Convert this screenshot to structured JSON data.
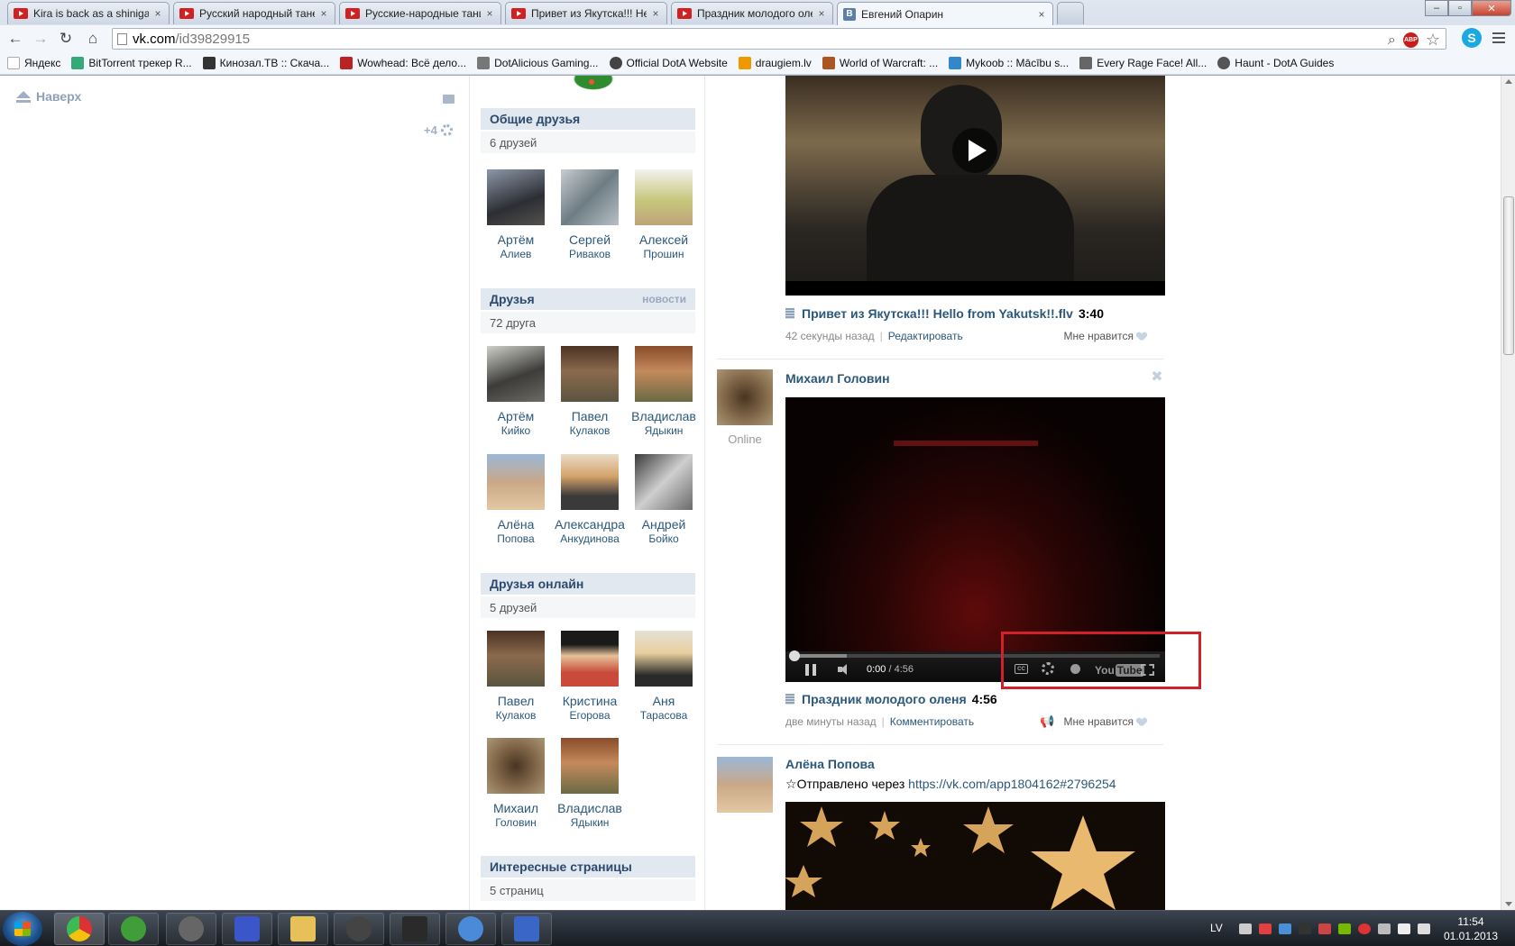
{
  "browser": {
    "tabs": [
      {
        "label": "Kira is back as a shinigami",
        "icon": "youtube-icon"
      },
      {
        "label": "Русский народный танец",
        "icon": "youtube-icon"
      },
      {
        "label": "Русские-народные танцы",
        "icon": "youtube-icon"
      },
      {
        "label": "Привет из Якутска!!! Hello",
        "icon": "youtube-icon"
      },
      {
        "label": "Праздник молодого оленя",
        "icon": "youtube-icon"
      },
      {
        "label": "Евгений Опарин",
        "icon": "vk-icon",
        "vk_letter": "В"
      }
    ],
    "tab_close_glyph": "×",
    "url_host": "vk.com",
    "url_path": "/id39829915",
    "abp_label": "ABP",
    "bookmarks": [
      "Яндекс",
      "BitTorrent трекер R...",
      "Кинозал.ТВ :: Скача...",
      "Wowhead: Всё дело...",
      "DotAlicious Gaming...",
      "Official DotA Website",
      "draugiem.lv",
      "World of Warcraft: ...",
      "Mykoob :: Mācību s...",
      "Every Rage Face! All...",
      "Haunt - DotA Guides"
    ],
    "bookmark_colors": [
      "#d22",
      "#3a7",
      "#333",
      "#b22",
      "#555",
      "#444",
      "#e90",
      "#a52",
      "#38c",
      "#666",
      "#555"
    ]
  },
  "page": {
    "top_link": "Наверх",
    "notify_count": "+4",
    "modules": {
      "common_friends": {
        "title": "Общие друзья",
        "count": "6 друзей",
        "people": [
          {
            "first": "Артём",
            "last": "Алиев",
            "color": "#4a4e55"
          },
          {
            "first": "Сергей",
            "last": "Риваков",
            "color": "#8c9aa3"
          },
          {
            "first": "Алексей",
            "last": "Прошин",
            "color": "#c9c47a"
          }
        ]
      },
      "friends": {
        "title": "Друзья",
        "link": "новости",
        "count": "72 друга",
        "people": [
          {
            "first": "Артём",
            "last": "Кийко",
            "color": "#5a5a56"
          },
          {
            "first": "Павел",
            "last": "Кулаков",
            "color": "#7a5a3e"
          },
          {
            "first": "Владислав",
            "last": "Ядыкин",
            "color": "#b27a4e"
          },
          {
            "first": "Алёна",
            "last": "Попова",
            "color": "#d6b88d"
          },
          {
            "first": "Александра",
            "last": "Анкудинова",
            "color": "#c8b096"
          },
          {
            "first": "Андрей",
            "last": "Бойко",
            "color": "#8a8a8a"
          }
        ]
      },
      "friends_online": {
        "title": "Друзья онлайн",
        "count": "5 друзей",
        "people": [
          {
            "first": "Павел",
            "last": "Кулаков",
            "color": "#7a5a3e"
          },
          {
            "first": "Кристина",
            "last": "Егорова",
            "color": "#b89a72"
          },
          {
            "first": "Аня",
            "last": "Тарасова",
            "color": "#cfc3b6"
          },
          {
            "first": "Михаил",
            "last": "Головин",
            "color": "#6a5540"
          },
          {
            "first": "Владислав",
            "last": "Ядыкин",
            "color": "#b27a4e"
          }
        ]
      },
      "interesting_pages": {
        "title": "Интересные страницы",
        "count": "5 страниц"
      }
    },
    "feed": {
      "post1": {
        "title": "Привет из Якутска!!! Hello from Yakutsk!!.flv",
        "duration": "3:40",
        "time": "42 секунды назад",
        "action": "Редактировать",
        "like": "Мне нравится"
      },
      "post2": {
        "author": "Михаил Головин",
        "status": "Online",
        "player_time": "0:00",
        "player_total": "/ 4:56",
        "cc_label": "CC",
        "yt_you": "You",
        "yt_tube": "Tube",
        "title": "Праздник молодого оленя",
        "duration": "4:56",
        "time": "две минуты назад",
        "action": "Комментировать",
        "like": "Мне нравится"
      },
      "post3": {
        "author": "Алёна Попова",
        "sent_text": "Отправлено через",
        "sent_link": "https://vk.com/app1804162#2796254"
      }
    }
  },
  "taskbar": {
    "lang": "LV",
    "time": "11:54",
    "date": "01.01.2013",
    "apps": [
      {
        "name": "chrome",
        "color": "#e8b32a"
      },
      {
        "name": "utorrent",
        "color": "#3f9d3a"
      },
      {
        "name": "steelseries",
        "color": "#666"
      },
      {
        "name": "mpc",
        "color": "#3b56c8"
      },
      {
        "name": "explorer",
        "color": "#e8c05a"
      },
      {
        "name": "steam",
        "color": "#444"
      },
      {
        "name": "media",
        "color": "#2a2a2a"
      },
      {
        "name": "itunes",
        "color": "#4a8ad8"
      },
      {
        "name": "program",
        "color": "#3a66c8"
      }
    ]
  }
}
